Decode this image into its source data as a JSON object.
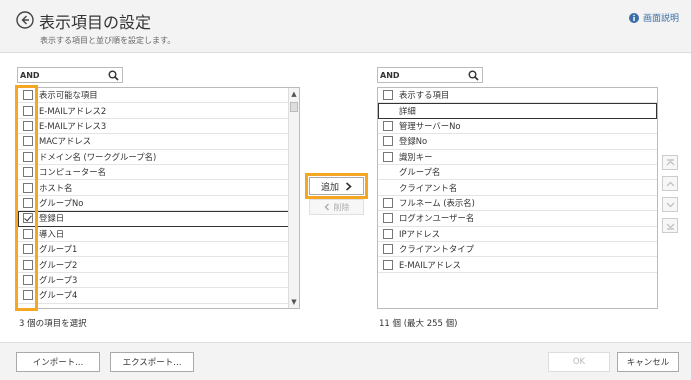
{
  "header": {
    "title": "表示項目の設定",
    "subtitle": "表示する項目と並び順を設定します。",
    "help_label": "画面説明"
  },
  "available": {
    "search_value": "AND",
    "header_label": "表示可能な項目",
    "items": [
      {
        "label": "E-MAILアドレス2",
        "checked": false
      },
      {
        "label": "E-MAILアドレス3",
        "checked": false
      },
      {
        "label": "MACアドレス",
        "checked": false
      },
      {
        "label": "ドメイン名 (ワークグループ名)",
        "checked": false
      },
      {
        "label": "コンピューター名",
        "checked": false
      },
      {
        "label": "ホスト名",
        "checked": false
      },
      {
        "label": "グループNo",
        "checked": false
      },
      {
        "label": "登録日",
        "checked": true
      },
      {
        "label": "導入日",
        "checked": false
      },
      {
        "label": "グループ1",
        "checked": false
      },
      {
        "label": "グループ2",
        "checked": false
      },
      {
        "label": "グループ3",
        "checked": false
      },
      {
        "label": "グループ4",
        "checked": false
      }
    ],
    "count_text": "3 個の項目を選択"
  },
  "actions": {
    "add_label": "追加",
    "add_icon": "chevron-right-icon",
    "remove_label": "削除",
    "remove_icon": "chevron-left-icon"
  },
  "selected": {
    "search_value": "AND",
    "header_label": "表示する項目",
    "items": [
      {
        "label": "詳細",
        "has_checkbox": false
      },
      {
        "label": "管理サーバーNo",
        "has_checkbox": true
      },
      {
        "label": "登録No",
        "has_checkbox": true
      },
      {
        "label": "識別キー",
        "has_checkbox": true
      },
      {
        "label": "グループ名",
        "has_checkbox": false
      },
      {
        "label": "クライアント名",
        "has_checkbox": false
      },
      {
        "label": "フルネーム (表示名)",
        "has_checkbox": true
      },
      {
        "label": "ログオンユーザー名",
        "has_checkbox": true
      },
      {
        "label": "IPアドレス",
        "has_checkbox": true
      },
      {
        "label": "クライアントタイプ",
        "has_checkbox": true
      },
      {
        "label": "E-MAILアドレス",
        "has_checkbox": true
      }
    ],
    "count_text": "11 個 (最大 255 個)"
  },
  "footer": {
    "import_label": "インポート...",
    "export_label": "エクスポート...",
    "ok_label": "OK",
    "cancel_label": "キャンセル"
  },
  "colors": {
    "highlight": "#f5a623",
    "link": "#3a6ea5"
  }
}
